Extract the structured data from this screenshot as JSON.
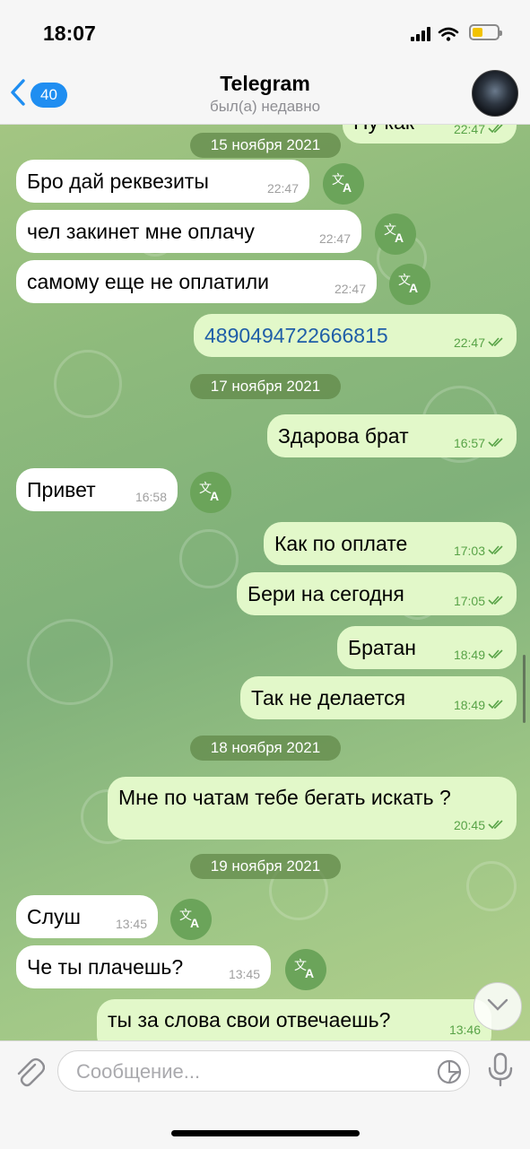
{
  "status_bar": {
    "time": "18:07"
  },
  "header": {
    "back_count": "40",
    "title": "Telegram",
    "subtitle": "был(а) недавно"
  },
  "messages": [
    {
      "direction": "out",
      "text": "Ну как",
      "time": "22:47",
      "read": true
    },
    {
      "date": "15 ноября 2021"
    },
    {
      "direction": "in",
      "text": "Бро дай реквезиты",
      "time": "22:47"
    },
    {
      "direction": "in",
      "text": "чел закинет мне оплачу",
      "time": "22:47"
    },
    {
      "direction": "in",
      "text": "самому еще не оплатили",
      "time": "22:47"
    },
    {
      "direction": "out",
      "text": "4890494722666815",
      "time": "22:47",
      "read": true
    },
    {
      "date": "17 ноября 2021"
    },
    {
      "direction": "out",
      "text": "Здарова брат",
      "time": "16:57",
      "read": true
    },
    {
      "direction": "in",
      "text": "Привет",
      "time": "16:58"
    },
    {
      "direction": "out",
      "text": "Как по оплате",
      "time": "17:03",
      "read": true
    },
    {
      "direction": "out",
      "text": "Бери на сегодня",
      "time": "17:05",
      "read": true
    },
    {
      "direction": "out",
      "text": "Братан",
      "time": "18:49",
      "read": true
    },
    {
      "direction": "out",
      "text": "Так не делается",
      "time": "18:49",
      "read": true
    },
    {
      "date": "18 ноября 2021"
    },
    {
      "direction": "out",
      "text": "Мне по чатам тебе бегать искать ?",
      "time": "20:45",
      "read": true
    },
    {
      "date": "19 ноября 2021"
    },
    {
      "direction": "in",
      "text": "Слуш",
      "time": "13:45"
    },
    {
      "direction": "in",
      "text": "Че ты плачешь?",
      "time": "13:45"
    },
    {
      "direction": "out",
      "text": "ты за слова свои отвечаешь?",
      "time": "13:46"
    }
  ],
  "input": {
    "placeholder": "Сообщение..."
  },
  "colors": {
    "accent": "#1f8ef1",
    "outgoing_bubble": "#e2f8c9",
    "incoming_bubble": "#ffffff",
    "read_check": "#58a347",
    "date_pill": "#5f8746",
    "translate_button": "#6ba45a"
  },
  "icons": {
    "back": "chevron-left-icon",
    "translate": "translate-icon",
    "checks": "double-check-icon",
    "attach": "paperclip-icon",
    "sticker": "sticker-icon",
    "mic": "microphone-icon",
    "scroll_down": "chevron-down-icon"
  }
}
